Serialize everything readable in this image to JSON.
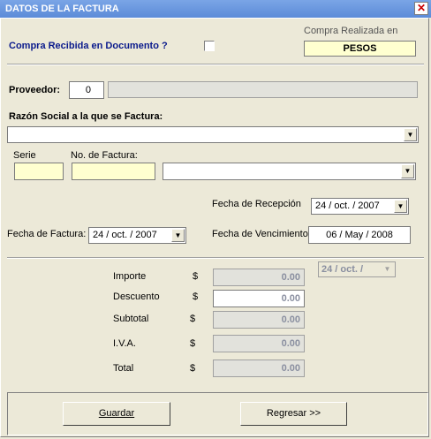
{
  "window": {
    "title": "DATOS DE LA FACTURA",
    "close_glyph": "✕"
  },
  "compra_recibida": {
    "label": "Compra Recibida en Documento ?",
    "checked": false
  },
  "compra_realizada": {
    "label": "Compra Realizada en",
    "currency": "PESOS"
  },
  "proveedor": {
    "label": "Proveedor:",
    "value": "0",
    "name": ""
  },
  "razon_social": {
    "label": "Razón Social a la que se Factura:",
    "value": ""
  },
  "serie": {
    "label": "Serie",
    "value": ""
  },
  "no_factura": {
    "label": "No. de Factura:",
    "value": "",
    "combo": ""
  },
  "fecha_recepcion": {
    "label": "Fecha de Recepción",
    "value": "24 / oct. / 2007"
  },
  "fecha_factura": {
    "label": "Fecha de Factura:",
    "value": "24 /  oct.  / 2007"
  },
  "fecha_vencimiento": {
    "label": "Fecha de Vencimiento",
    "value": "06 / May / 2008"
  },
  "fecha_extra": {
    "value": "24 /  oct.  /"
  },
  "amounts": [
    {
      "label": "Importe",
      "currency": "$",
      "value": "0.00",
      "editable": false
    },
    {
      "label": "Descuento",
      "currency": "$",
      "value": "0.00",
      "editable": true
    },
    {
      "label": "Subtotal",
      "currency": "$",
      "value": "0.00",
      "editable": false
    },
    {
      "label": "I.V.A.",
      "currency": "$",
      "value": "0.00",
      "editable": false
    },
    {
      "label": "Total",
      "currency": "$",
      "value": "0.00",
      "editable": false
    }
  ],
  "buttons": {
    "guardar": "Guardar",
    "regresar": "Regresar >>"
  },
  "icons": {
    "dropdown": "▼"
  },
  "colors": {
    "title_bar": "#6b97df",
    "label_navy": "#0a1a8c",
    "yellow_field": "#ffffd0",
    "disabled_text": "#8a8fa0"
  }
}
